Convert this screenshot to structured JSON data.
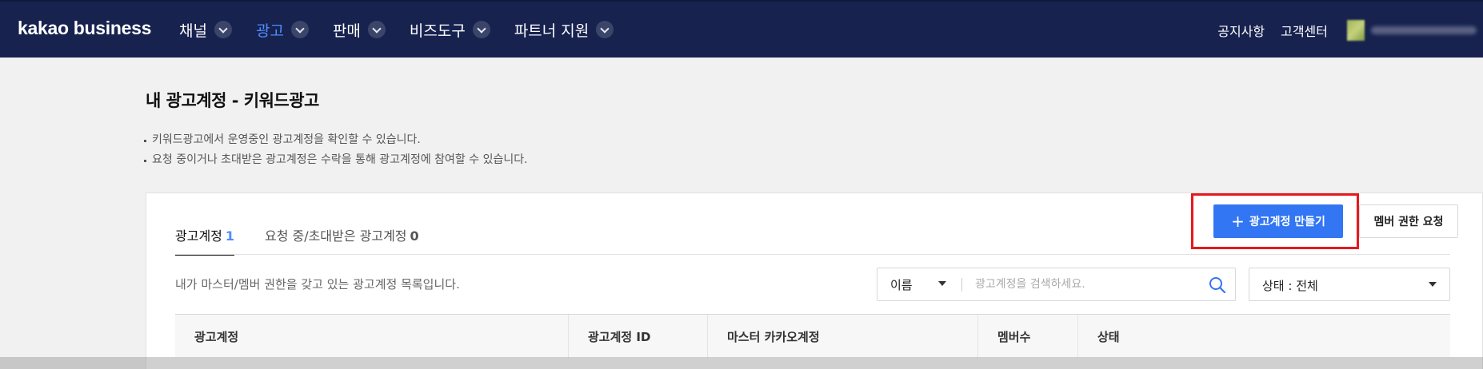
{
  "header": {
    "logo": "kakao business",
    "nav": [
      {
        "label": "채널",
        "active": false
      },
      {
        "label": "광고",
        "active": true
      },
      {
        "label": "판매",
        "active": false
      },
      {
        "label": "비즈도구",
        "active": false
      },
      {
        "label": "파트너 지원",
        "active": false
      }
    ],
    "links": {
      "notice": "공지사항",
      "support": "고객센터"
    }
  },
  "page": {
    "title": "내 광고계정 - 키워드광고",
    "notes": [
      "키워드광고에서 운영중인 광고계정을 확인할 수 있습니다.",
      "요청 중이거나 초대받은 광고계정은 수락을 통해 광고계정에 참여할 수 있습니다."
    ]
  },
  "tabs": [
    {
      "label": "광고계정",
      "count": "1",
      "active": true
    },
    {
      "label": "요청 중/초대받은 광고계정",
      "count": "0",
      "active": false
    }
  ],
  "actions": {
    "create_label": "광고계정 만들기",
    "member_request_label": "멤버 권한 요청"
  },
  "list": {
    "description": "내가 마스터/멤버 권한을 갖고 있는 광고계정 목록입니다.",
    "search_type": "이름",
    "search_placeholder": "광고계정을 검색하세요.",
    "status_filter": "상태 : 전체"
  },
  "table": {
    "columns": [
      "광고계정",
      "광고계정 ID",
      "마스터 카카오계정",
      "멤버수",
      "상태"
    ]
  },
  "colors": {
    "topbar": "#17224f",
    "accent": "#3276f3",
    "active_nav": "#4f8dff",
    "highlight": "#e5191d"
  }
}
